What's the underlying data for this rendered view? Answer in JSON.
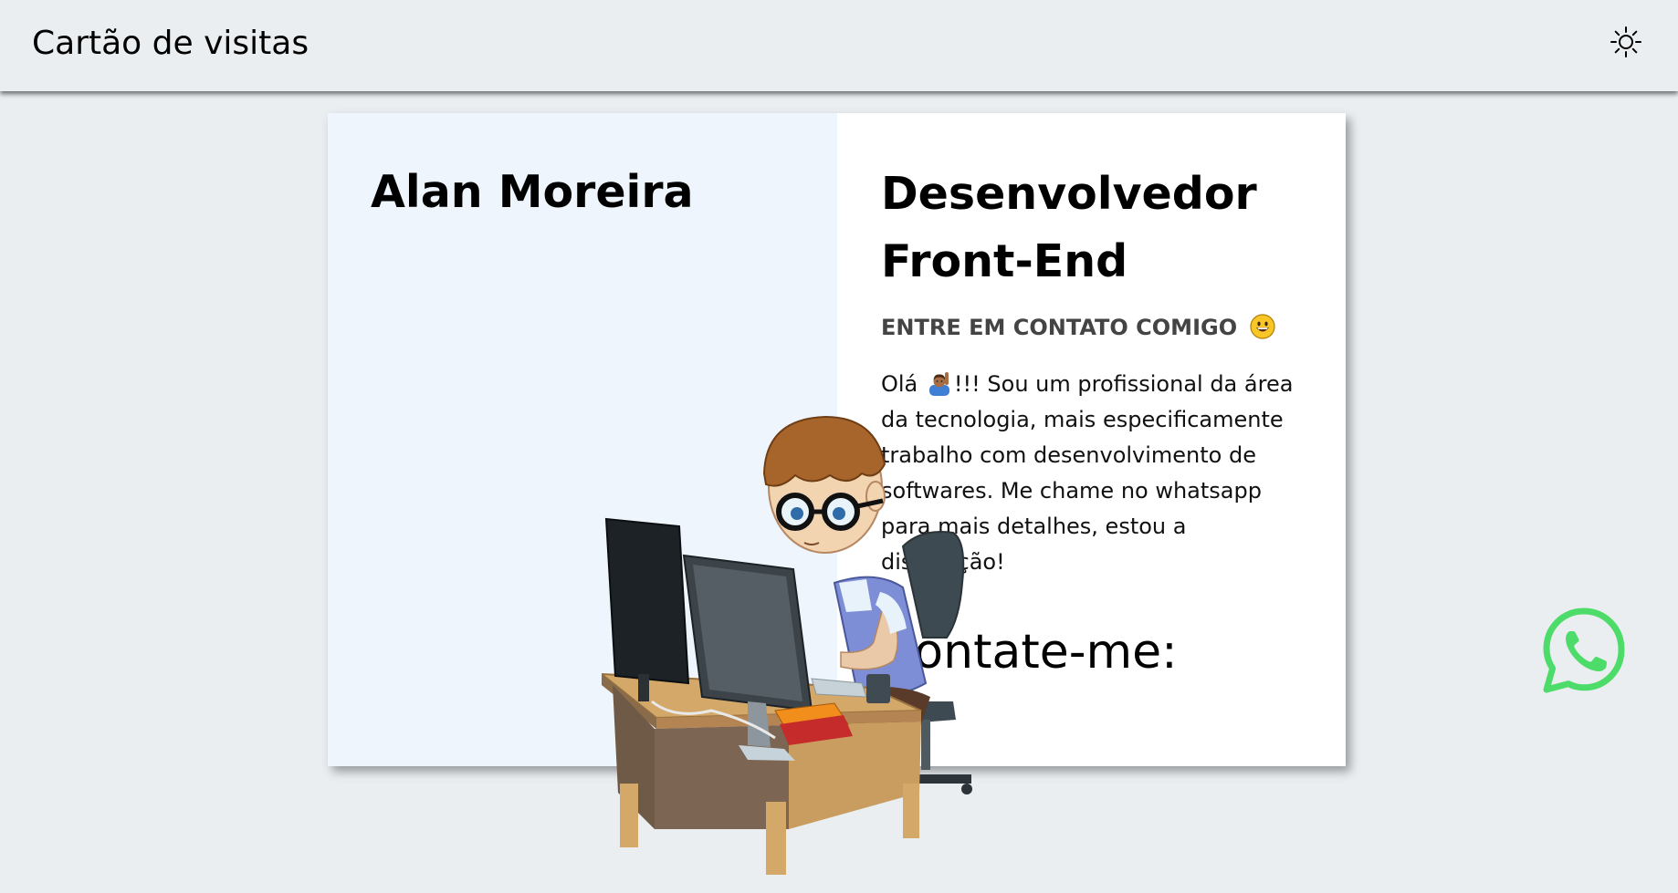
{
  "header": {
    "title": "Cartão de visitas",
    "theme_icon": "sun-icon"
  },
  "card": {
    "name": "Alan Moreira",
    "role": "Desenvolvedor Front-End",
    "contact_heading": "ENTRE EM CONTATO COMIGO",
    "contact_heading_emoji": "grinning-face-emoji",
    "bio_greeting": "Olá",
    "bio_greeting_emoji": "person-raising-hand-emoji",
    "bio_text": "!!! Sou um profissional da área da tecnologia, mais especificamente trabalho com desenvolvimento de softwares. Me chame no whatsapp para mais detalhes, estou a disposição!",
    "cta_label": "Contate-me:",
    "cta_icon": "whatsapp-icon",
    "illustration": "developer-at-desk-illustration"
  },
  "colors": {
    "page_background": "#eaeef1",
    "card_left_background": "#eef5fc",
    "card_right_background": "#ffffff",
    "whatsapp_green": "#4ddc6a"
  }
}
